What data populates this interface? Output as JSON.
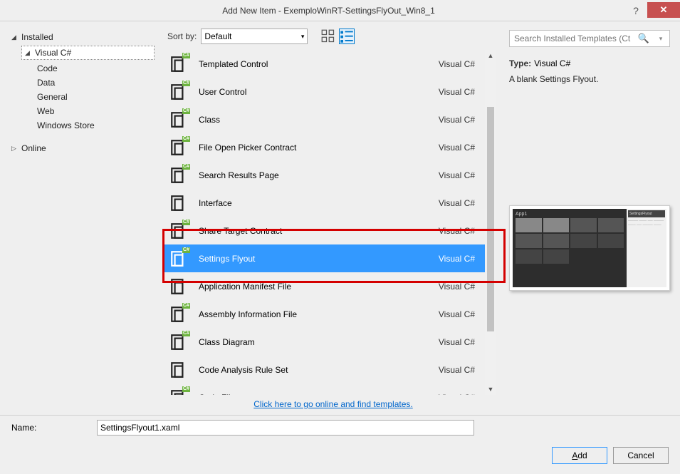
{
  "window": {
    "title": "Add New Item - ExemploWinRT-SettingsFlyOut_Win8_1"
  },
  "tree": {
    "installed": "Installed",
    "csharp": "Visual C#",
    "children": [
      "Code",
      "Data",
      "General",
      "Web",
      "Windows Store"
    ],
    "online": "Online"
  },
  "sort": {
    "label": "Sort by:",
    "value": "Default"
  },
  "search": {
    "placeholder": "Search Installed Templates (Ctrl+E)"
  },
  "info": {
    "type_label": "Type:",
    "type_value": "Visual C#",
    "description": "A blank Settings Flyout."
  },
  "templates": [
    {
      "name": "Templated Control",
      "lang": "Visual C#",
      "badge": true
    },
    {
      "name": "User Control",
      "lang": "Visual C#",
      "badge": true
    },
    {
      "name": "Class",
      "lang": "Visual C#",
      "badge": true
    },
    {
      "name": "File Open Picker Contract",
      "lang": "Visual C#",
      "badge": true
    },
    {
      "name": "Search Results Page",
      "lang": "Visual C#",
      "badge": true
    },
    {
      "name": "Interface",
      "lang": "Visual C#",
      "badge": false
    },
    {
      "name": "Share Target Contract",
      "lang": "Visual C#",
      "badge": true
    },
    {
      "name": "Settings Flyout",
      "lang": "Visual C#",
      "badge": true,
      "selected": true
    },
    {
      "name": "Application Manifest File",
      "lang": "Visual C#",
      "badge": false
    },
    {
      "name": "Assembly Information File",
      "lang": "Visual C#",
      "badge": true
    },
    {
      "name": "Class Diagram",
      "lang": "Visual C#",
      "badge": true
    },
    {
      "name": "Code Analysis Rule Set",
      "lang": "Visual C#",
      "badge": false
    },
    {
      "name": "Code File",
      "lang": "Visual C#",
      "badge": true
    }
  ],
  "online_link": "Click here to go online and find templates.",
  "name_label": "Name:",
  "name_value": "SettingsFlyout1.xaml",
  "preview": {
    "app_title": "App1",
    "flyout_title": "SettingsFlyout"
  },
  "buttons": {
    "add": "Add",
    "cancel": "Cancel"
  }
}
